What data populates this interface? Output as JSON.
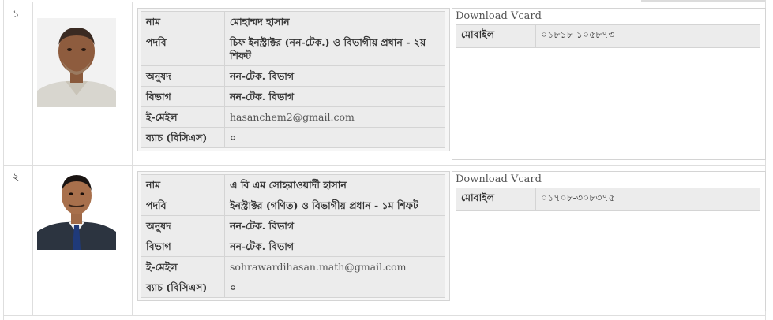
{
  "rows": [
    {
      "serial": "১",
      "fields": [
        {
          "label": "নাম",
          "value": "মোহাম্মদ হাসান"
        },
        {
          "label": "পদবি",
          "value": "চিফ ইনস্ট্রাক্টর (নন-টেক.) ও বিভাগীয় প্রধান - ২য় শিফট"
        },
        {
          "label": "অনুষদ",
          "value": "নন-টেক. বিভাগ"
        },
        {
          "label": "বিভাগ",
          "value": "নন-টেক. বিভাগ"
        },
        {
          "label": "ই-মেইল",
          "value": "hasanchem2@gmail.com"
        },
        {
          "label": "ব্যাচ (বিসিএস)",
          "value": "০"
        }
      ],
      "download_label": "Download Vcard",
      "mobile_label": "মোবাইল",
      "mobile_value": "০১৮১৮-১০৫৮৭৩"
    },
    {
      "serial": "২",
      "fields": [
        {
          "label": "নাম",
          "value": "এ বি এম সোহরাওয়ার্দী হাসান"
        },
        {
          "label": "পদবি",
          "value": "ইনস্ট্রাক্টর (গণিত) ও বিভাগীয় প্রধান - ১ম শিফট"
        },
        {
          "label": "অনুষদ",
          "value": "নন-টেক. বিভাগ"
        },
        {
          "label": "বিভাগ",
          "value": "নন-টেক. বিভাগ"
        },
        {
          "label": "ই-মেইল",
          "value": "sohrawardihasan.math@gmail.com"
        },
        {
          "label": "ব্যাচ (বিসিএস)",
          "value": "০"
        }
      ],
      "download_label": "Download Vcard",
      "mobile_label": "মোবাইল",
      "mobile_value": "০১৭০৮-৩০৮৩৭৫"
    }
  ]
}
